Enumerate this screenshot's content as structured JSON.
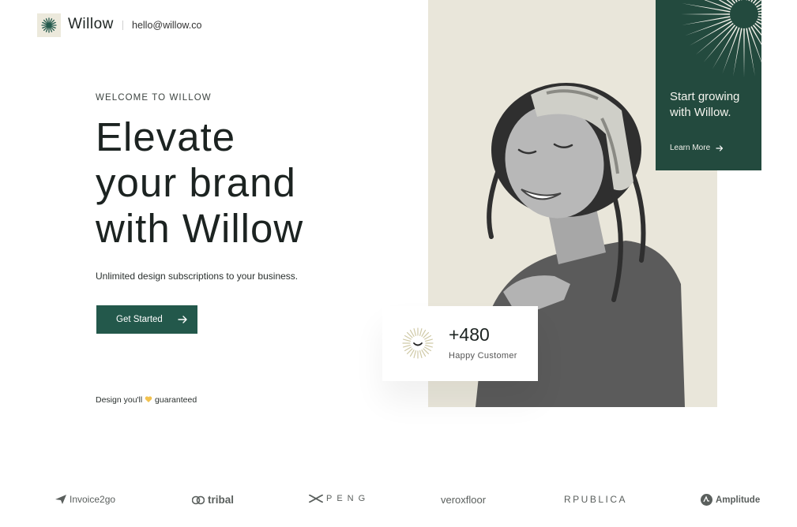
{
  "header": {
    "brand": "Willow",
    "email": "hello@willow.co",
    "logo_icon": "sunburst-logo-icon"
  },
  "hero": {
    "eyebrow": "WELCOME TO WILLOW",
    "headline_lines": [
      "Elevate",
      "your brand",
      "with Willow"
    ],
    "subtext": "Unlimited design subscriptions to your business.",
    "cta_label": "Get Started",
    "guarantee_before": "Design you'll",
    "guarantee_after": "guaranteed"
  },
  "promo": {
    "title": "Start growing with Willow.",
    "link_label": "Learn More"
  },
  "stat": {
    "value": "+480",
    "label": "Happy Customer"
  },
  "logos": [
    "Invoice2go",
    "tribal",
    "PENG",
    "veroxfloor",
    "RPUBLICA",
    "Amplitude"
  ],
  "colors": {
    "accent": "#23584b",
    "promo_bg": "#234a3e",
    "panel_bg": "#e9e6da",
    "text": "#1c2321"
  }
}
